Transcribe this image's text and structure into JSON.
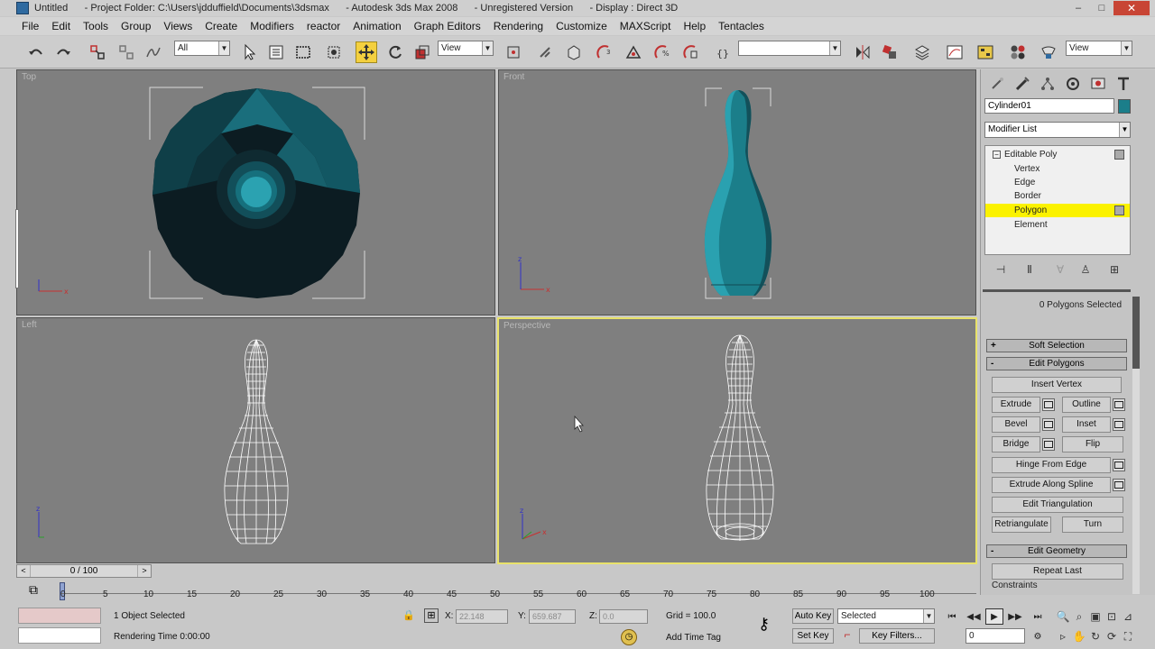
{
  "window": {
    "title": "Untitled      - Project Folder: C:\\Users\\jdduffield\\Documents\\3dsmax      - Autodesk 3ds Max 2008      - Unregistered Version      - Display : Direct 3D",
    "minimize": "–",
    "maximize": "□",
    "close": "✕"
  },
  "menu": [
    "File",
    "Edit",
    "Tools",
    "Group",
    "Views",
    "Create",
    "Modifiers",
    "reactor",
    "Animation",
    "Graph Editors",
    "Rendering",
    "Customize",
    "MAXScript",
    "Help",
    "Tentacles"
  ],
  "toolbar": {
    "selection_filter": "All",
    "ref_coord": "View",
    "named_selection": "",
    "view_dropdown": "View"
  },
  "viewports": {
    "top": "Top",
    "front": "Front",
    "left": "Left",
    "perspective": "Perspective"
  },
  "command_panel": {
    "object_name": "Cylinder01",
    "object_color": "#1b7e8a",
    "modifier_list": "Modifier List",
    "stack": [
      "Editable Poly",
      "Vertex",
      "Edge",
      "Border",
      "Polygon",
      "Element"
    ],
    "selected_stack_item": "Polygon",
    "selection_status": "0 Polygons Selected",
    "rollouts": {
      "soft_selection": "Soft Selection",
      "edit_polygons": "Edit Polygons",
      "edit_geometry": "Edit Geometry"
    },
    "buttons": {
      "insert_vertex": "Insert Vertex",
      "extrude": "Extrude",
      "outline": "Outline",
      "bevel": "Bevel",
      "inset": "Inset",
      "bridge": "Bridge",
      "flip": "Flip",
      "hinge_from_edge": "Hinge From Edge",
      "extrude_along_spline": "Extrude Along Spline",
      "edit_triangulation": "Edit Triangulation",
      "retriangulate": "Retriangulate",
      "turn": "Turn",
      "repeat_last": "Repeat Last",
      "constraints": "Constraints"
    },
    "rollout_signs": {
      "collapsed": "+",
      "expanded": "-"
    }
  },
  "timeline": {
    "frame_display": "0 / 100",
    "ticks": [
      "0",
      "5",
      "10",
      "15",
      "20",
      "25",
      "30",
      "35",
      "40",
      "45",
      "50",
      "55",
      "60",
      "65",
      "70",
      "75",
      "80",
      "85",
      "90",
      "95",
      "100"
    ]
  },
  "status": {
    "selection_info": "1 Object Selected",
    "prompt": "Rendering Time  0:00:00",
    "x_label": "X:",
    "x_value": "22.148",
    "y_label": "Y:",
    "y_value": "659.687",
    "z_label": "Z:",
    "z_value": "0.0",
    "grid": "Grid = 100.0",
    "add_time_tag": "Add Time Tag",
    "auto_key": "Auto Key",
    "set_key": "Set Key",
    "key_mode": "Selected",
    "key_filters": "Key Filters...",
    "current_frame": "0"
  }
}
